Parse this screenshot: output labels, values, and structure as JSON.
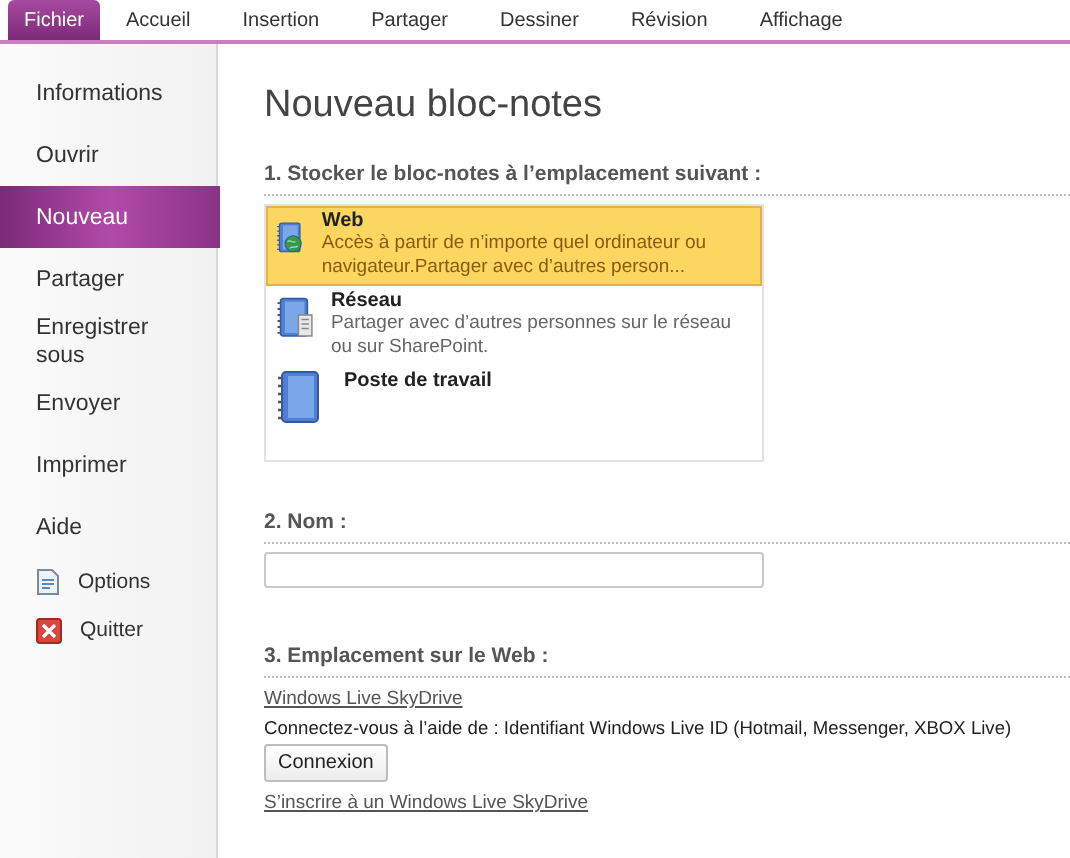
{
  "tabs": [
    {
      "label": "Fichier",
      "selected": true
    },
    {
      "label": "Accueil",
      "selected": false
    },
    {
      "label": "Insertion",
      "selected": false
    },
    {
      "label": "Partager",
      "selected": false
    },
    {
      "label": "Dessiner",
      "selected": false
    },
    {
      "label": "Révision",
      "selected": false
    },
    {
      "label": "Affichage",
      "selected": false
    }
  ],
  "sidebar": {
    "items": [
      {
        "label": "Informations",
        "kind": "page",
        "selected": false
      },
      {
        "label": "Ouvrir",
        "kind": "page",
        "selected": false
      },
      {
        "label": "Nouveau",
        "kind": "page",
        "selected": true
      },
      {
        "label": "Partager",
        "kind": "page",
        "selected": false
      },
      {
        "label": "Enregistrer sous",
        "kind": "page",
        "selected": false
      },
      {
        "label": "Envoyer",
        "kind": "page",
        "selected": false
      },
      {
        "label": "Imprimer",
        "kind": "page",
        "selected": false
      },
      {
        "label": "Aide",
        "kind": "page",
        "selected": false
      },
      {
        "label": "Options",
        "kind": "command",
        "selected": false
      },
      {
        "label": "Quitter",
        "kind": "command",
        "selected": false
      }
    ]
  },
  "title": "Nouveau bloc-notes",
  "section_1": {
    "heading": "1. Stocker le bloc-notes à l’emplacement suivant :",
    "locations": [
      {
        "name": "Web",
        "description": "Accès à partir de n’importe quel ordinateur ou navigateur.Partager avec d’autres person...",
        "selected": true
      },
      {
        "name": "Réseau",
        "description": "Partager avec d’autres personnes sur le réseau ou sur SharePoint.",
        "selected": false
      },
      {
        "name": "Poste de travail",
        "selected": false
      }
    ]
  },
  "section_2": {
    "heading": "2. Nom :"
  },
  "section_3": {
    "heading": "3. Emplacement sur le Web :",
    "service_link": "Windows Live SkyDrive",
    "info": "Connectez-vous à l’aide de : Identifiant Windows Live ID (Hotmail, Messenger, XBOX Live)",
    "button": "Connexion",
    "signup_link": "S’inscrire à un Windows Live SkyDrive"
  }
}
